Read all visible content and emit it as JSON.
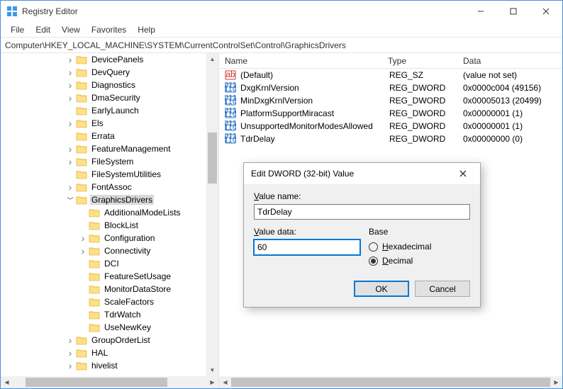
{
  "window": {
    "title": "Registry Editor"
  },
  "menubar": {
    "file": "File",
    "edit": "Edit",
    "view": "View",
    "favorites": "Favorites",
    "help": "Help"
  },
  "addressbar": "Computer\\HKEY_LOCAL_MACHINE\\SYSTEM\\CurrentControlSet\\Control\\GraphicsDrivers",
  "tree": [
    {
      "indent": 5,
      "exp": ">",
      "label": "DevicePanels"
    },
    {
      "indent": 5,
      "exp": ">",
      "label": "DevQuery"
    },
    {
      "indent": 5,
      "exp": ">",
      "label": "Diagnostics"
    },
    {
      "indent": 5,
      "exp": ">",
      "label": "DmaSecurity"
    },
    {
      "indent": 5,
      "exp": "",
      "label": "EarlyLaunch"
    },
    {
      "indent": 5,
      "exp": ">",
      "label": "Els"
    },
    {
      "indent": 5,
      "exp": "",
      "label": "Errata"
    },
    {
      "indent": 5,
      "exp": ">",
      "label": "FeatureManagement"
    },
    {
      "indent": 5,
      "exp": ">",
      "label": "FileSystem"
    },
    {
      "indent": 5,
      "exp": "",
      "label": "FileSystemUtilities"
    },
    {
      "indent": 5,
      "exp": ">",
      "label": "FontAssoc"
    },
    {
      "indent": 5,
      "exp": "v",
      "label": "GraphicsDrivers",
      "selected": true
    },
    {
      "indent": 6,
      "exp": "",
      "label": "AdditionalModeLists"
    },
    {
      "indent": 6,
      "exp": "",
      "label": "BlockList"
    },
    {
      "indent": 6,
      "exp": ">",
      "label": "Configuration"
    },
    {
      "indent": 6,
      "exp": ">",
      "label": "Connectivity"
    },
    {
      "indent": 6,
      "exp": "",
      "label": "DCI"
    },
    {
      "indent": 6,
      "exp": "",
      "label": "FeatureSetUsage"
    },
    {
      "indent": 6,
      "exp": "",
      "label": "MonitorDataStore"
    },
    {
      "indent": 6,
      "exp": "",
      "label": "ScaleFactors"
    },
    {
      "indent": 6,
      "exp": "",
      "label": "TdrWatch"
    },
    {
      "indent": 6,
      "exp": "",
      "label": "UseNewKey"
    },
    {
      "indent": 5,
      "exp": ">",
      "label": "GroupOrderList"
    },
    {
      "indent": 5,
      "exp": ">",
      "label": "HAL"
    },
    {
      "indent": 5,
      "exp": ">",
      "label": "hivelist"
    }
  ],
  "list": {
    "columns": {
      "name": "Name",
      "type": "Type",
      "data": "Data"
    },
    "rows": [
      {
        "icon": "sz",
        "name": "(Default)",
        "type": "REG_SZ",
        "data": "(value not set)"
      },
      {
        "icon": "bin",
        "name": "DxgKrnlVersion",
        "type": "REG_DWORD",
        "data": "0x0000c004 (49156)"
      },
      {
        "icon": "bin",
        "name": "MinDxgKrnlVersion",
        "type": "REG_DWORD",
        "data": "0x00005013 (20499)"
      },
      {
        "icon": "bin",
        "name": "PlatformSupportMiracast",
        "type": "REG_DWORD",
        "data": "0x00000001 (1)"
      },
      {
        "icon": "bin",
        "name": "UnsupportedMonitorModesAllowed",
        "type": "REG_DWORD",
        "data": "0x00000001 (1)"
      },
      {
        "icon": "bin",
        "name": "TdrDelay",
        "type": "REG_DWORD",
        "data": "0x00000000 (0)"
      }
    ]
  },
  "dialog": {
    "title": "Edit DWORD (32-bit) Value",
    "value_name_label": "Value name:",
    "value_name": "TdrDelay",
    "value_data_label": "Value data:",
    "value_data": "60",
    "base_label": "Base",
    "hex_label": "Hexadecimal",
    "dec_label": "Decimal",
    "base_selected": "decimal",
    "ok": "OK",
    "cancel": "Cancel"
  }
}
